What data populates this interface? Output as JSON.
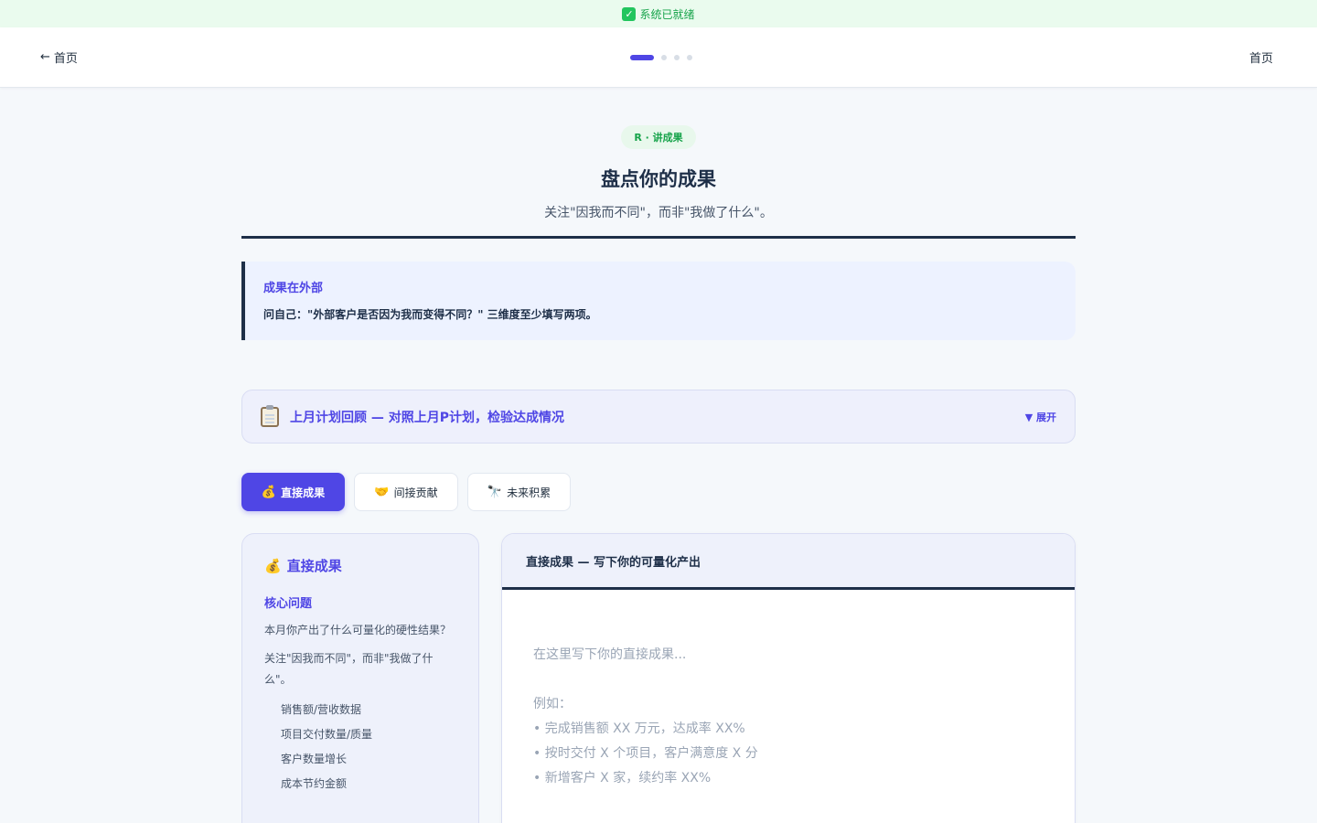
{
  "status_bar": {
    "text": "系统已就绪",
    "icon": "check-icon"
  },
  "nav": {
    "back_label": "首页",
    "right_label": "首页",
    "progress": {
      "current": 1,
      "total": 4
    }
  },
  "header": {
    "badge": "R · 讲成果",
    "title": "盘点你的成果",
    "subtitle": "关注\"因我而不同\"，而非\"我做了什么\"。"
  },
  "callout": {
    "title": "成果在外部",
    "body": "问自己：\"外部客户是否因为我而变得不同？\" 三维度至少填写两项。"
  },
  "review": {
    "title": "上月计划回顾 — 对照上月P计划，检验达成情况",
    "expand_label": "▼ 展开"
  },
  "tabs": [
    {
      "emoji": "💰",
      "label": "直接成果",
      "active": true
    },
    {
      "emoji": "🤝",
      "label": "间接贡献",
      "active": false
    },
    {
      "emoji": "🔭",
      "label": "未来积累",
      "active": false
    }
  ],
  "info_card": {
    "emoji": "💰",
    "title": "直接成果",
    "subtitle": "核心问题",
    "text1": "本月你产出了什么可量化的硬性结果？",
    "text2": "关注\"因我而不同\"，而非\"我做了什么\"。",
    "items": [
      "销售额/营收数据",
      "项目交付数量/质量",
      "客户数量增长",
      "成本节约金额"
    ]
  },
  "editor": {
    "header": "直接成果 — 写下你的可量化产出",
    "placeholder": "在这里写下你的直接成果...\n\n例如：\n• 完成销售额 XX 万元，达成率 XX%\n• 按时交付 X 个项目，客户满意度 X 分\n• 新增客户 X 家，续约率 XX%",
    "value": ""
  },
  "colors": {
    "accent": "#4f46e5",
    "navy": "#1e2f48",
    "success": "#16a34a",
    "status_bg": "#eafbee"
  }
}
